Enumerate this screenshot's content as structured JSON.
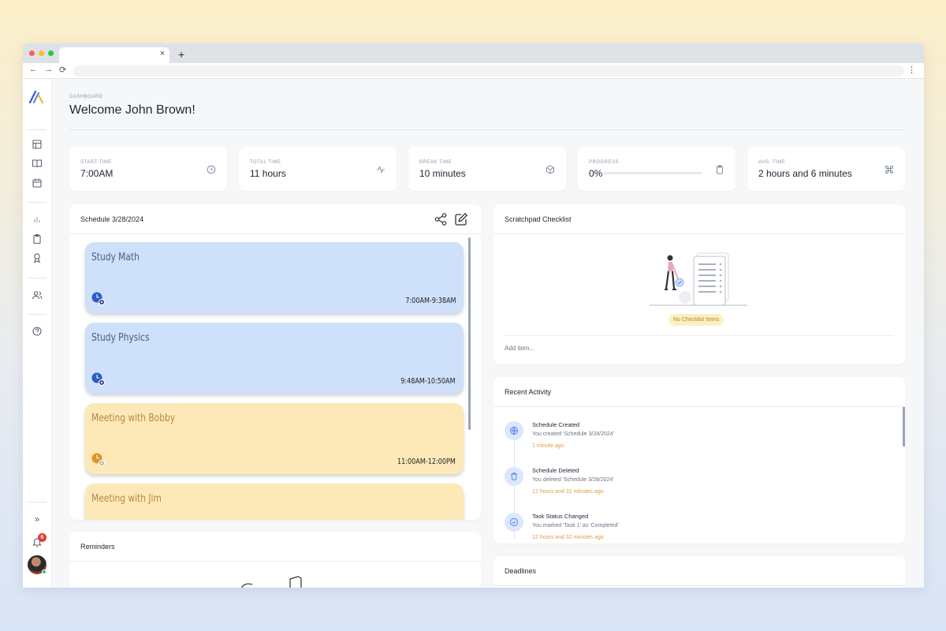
{
  "browser": {
    "tab_close": "×",
    "tab_new": "+",
    "back": "←",
    "forward": "→",
    "reload": "⟳",
    "menu": "⋮"
  },
  "header": {
    "breadcrumb": "DASHBOARD",
    "title": "Welcome John Brown!"
  },
  "stats": [
    {
      "label": "START TIME",
      "value": "7:00AM",
      "icon": "clock-icon"
    },
    {
      "label": "TOTAL TIME",
      "value": "11 hours",
      "icon": "activity-icon"
    },
    {
      "label": "BREAK TIME",
      "value": "10 minutes",
      "icon": "box-icon"
    },
    {
      "label": "PROGRESS",
      "value": "0%",
      "icon": "clipboard-icon",
      "progress": 0
    },
    {
      "label": "AVG. TIME",
      "value": "2 hours and 6 minutes",
      "icon": "command-icon"
    }
  ],
  "schedule": {
    "title": "Schedule 3/28/2024",
    "events": [
      {
        "title": "Study Math",
        "time": "7:00AM-9:38AM",
        "color": "#cfe0fa",
        "text_color": "#4a5d86"
      },
      {
        "title": "Study Physics",
        "time": "9:48AM-10:50AM",
        "color": "#cfe0fa",
        "text_color": "#4a5d86"
      },
      {
        "title": "Meeting with Bobby",
        "time": "11:00AM-12:00PM",
        "color": "#fde9b8",
        "text_color": "#b5874a"
      },
      {
        "title": "Meeting with Jim",
        "time": "",
        "color": "#fde9b8",
        "text_color": "#b5874a"
      }
    ]
  },
  "scratchpad": {
    "title": "Scratchpad Checklist",
    "empty_label": "No Checklist Items",
    "input_placeholder": "Add item..."
  },
  "activity": {
    "title": "Recent Activity",
    "items": [
      {
        "title": "Schedule Created",
        "desc": "You created 'Schedule 3/28/2024'",
        "time": "1 minute ago",
        "icon": "globe-icon"
      },
      {
        "title": "Schedule Deleted",
        "desc": "You deleted 'Schedule 3/28/2024'",
        "time": "12 hours and 31 minutes ago",
        "icon": "trash-icon"
      },
      {
        "title": "Task Status Changed",
        "desc": "You marked 'Task 1' as 'Completed'",
        "time": "12 hours and 32 minutes ago",
        "icon": "check-circle-icon"
      }
    ]
  },
  "reminders": {
    "title": "Reminders"
  },
  "deadlines": {
    "title": "Deadlines"
  },
  "sidebar": {
    "notification_count": "6",
    "collapse": "»"
  },
  "colors": {
    "accent": "#4a7cf0",
    "event_blue": "#cfe0fa",
    "event_yellow": "#fde9b8",
    "activity_time": "#e39a4a",
    "badge": "#e53935"
  }
}
